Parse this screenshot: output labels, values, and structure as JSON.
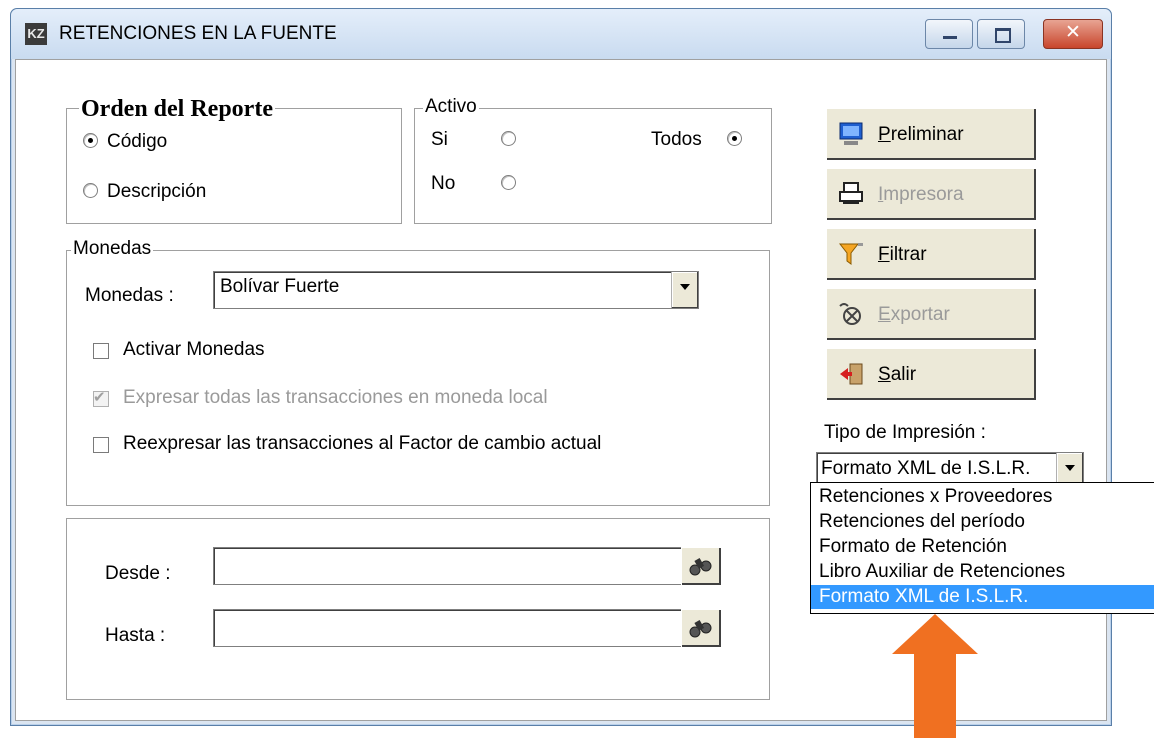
{
  "window": {
    "app_icon": "KZ",
    "title": "RETENCIONES EN LA FUENTE",
    "controls": {
      "minimize": "minimize-icon",
      "maximize": "maximize-icon",
      "close": "✕"
    }
  },
  "orden": {
    "legend": "Orden del Reporte",
    "options": [
      "Código",
      "Descripción"
    ],
    "selected": "Código"
  },
  "activo": {
    "legend": "Activo",
    "si": "Si",
    "no": "No",
    "todos": "Todos",
    "selected": "Todos"
  },
  "monedas": {
    "legend": "Monedas",
    "label": "Monedas :",
    "value": "Bolívar Fuerte",
    "activar": "Activar Monedas",
    "expresar": "Expresar todas las transacciones en moneda local",
    "reexpresar": "Reexpresar las transacciones al Factor de cambio actual"
  },
  "rango": {
    "desde_label": "Desde  :",
    "hasta_label": "Hasta   :",
    "desde_value": "",
    "hasta_value": ""
  },
  "buttons": {
    "preliminar": "Preliminar",
    "impresora": "Impresora",
    "filtrar": "Filtrar",
    "exportar": "Exportar",
    "salir": "Salir"
  },
  "tipo_impresion": {
    "label": "Tipo de Impresión :",
    "value": "Formato XML de I.S.L.R.",
    "options": [
      "Retenciones x Proveedores",
      "Retenciones del período",
      "Formato de Retención",
      "Libro Auxiliar de Retenciones",
      "Formato XML de I.S.L.R."
    ],
    "highlighted_index": 4
  },
  "colors": {
    "selection": "#3399ff",
    "arrow": "#f07021",
    "button_face": "#ece9d8"
  }
}
